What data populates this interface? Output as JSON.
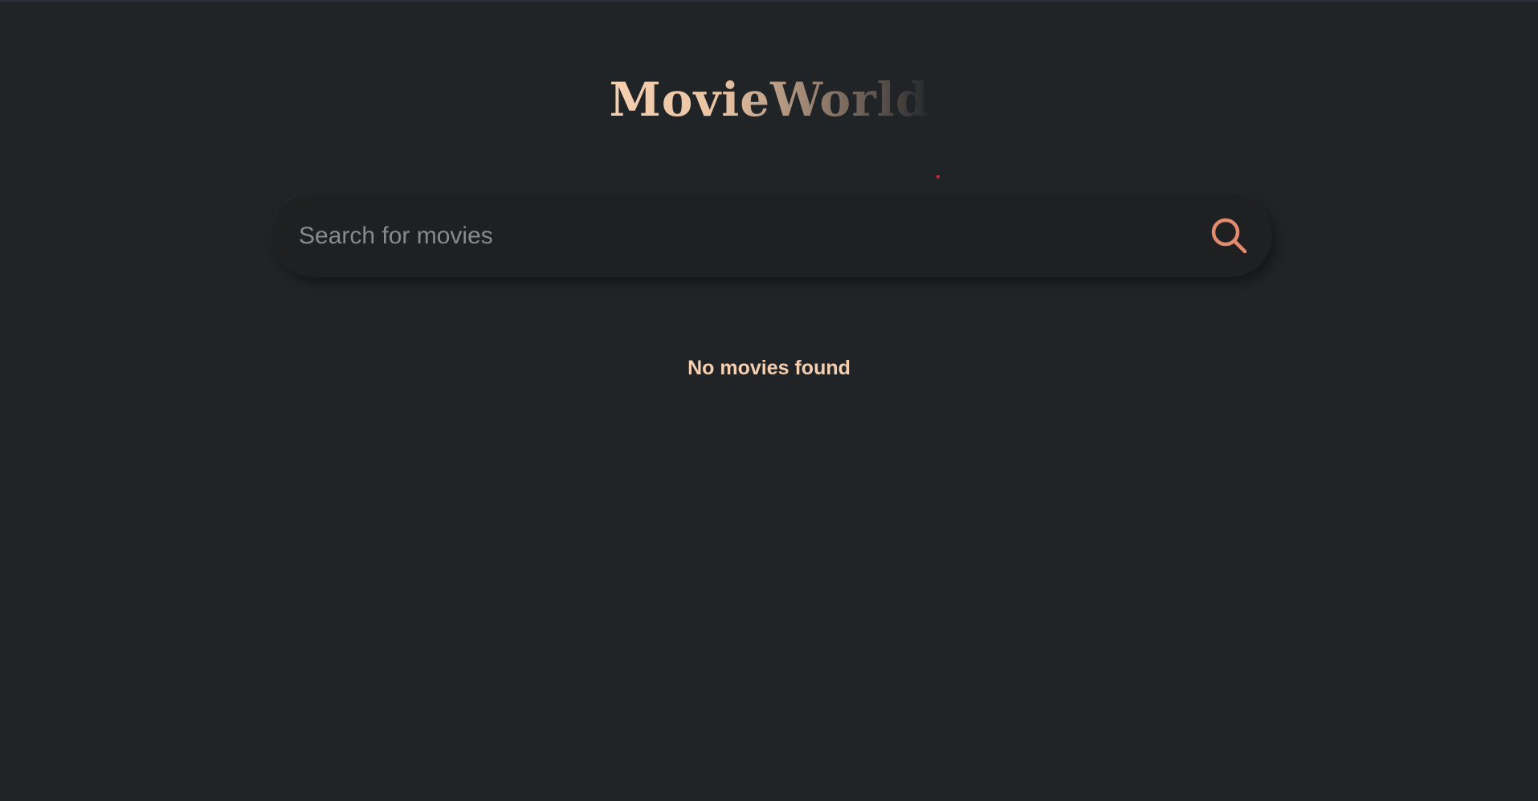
{
  "app": {
    "title": "MovieWorld"
  },
  "search": {
    "placeholder": "Search for movies",
    "value": "",
    "icon": "search-icon"
  },
  "results": {
    "empty_message": "No movies found"
  },
  "colors": {
    "background": "#212427",
    "accent": "#e38b6e",
    "title_light": "#f5cfb0",
    "message": "#f5cfb0"
  }
}
